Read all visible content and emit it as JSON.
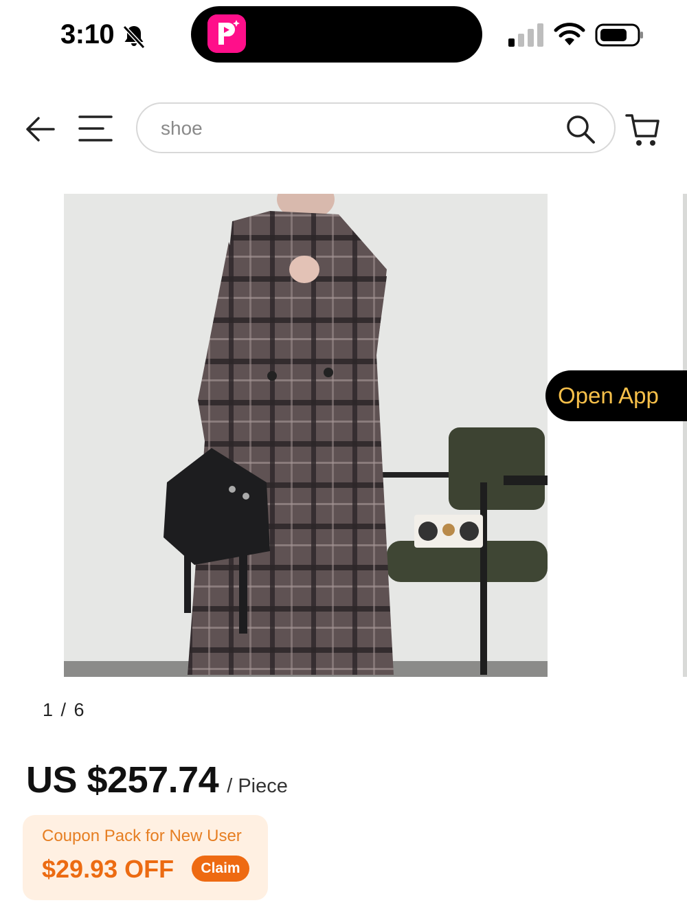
{
  "status_bar": {
    "time": "3:10",
    "icons": [
      "bell-slash-icon",
      "app-badge-icon",
      "signal-icon",
      "wifi-icon",
      "battery-icon"
    ]
  },
  "nav": {
    "search_value": "shoe",
    "icons": [
      "back-arrow-icon",
      "menu-icon",
      "search-icon",
      "cart-icon"
    ]
  },
  "gallery": {
    "counter": "1 / 6",
    "image_alt": "Plaid long coat product photo"
  },
  "open_app_label": "Open App",
  "price": {
    "amount": "US $257.74",
    "unit": "/ Piece"
  },
  "coupon": {
    "title": "Coupon Pack for New User",
    "amount": "$29.93 OFF",
    "claim_label": "Claim"
  },
  "colors": {
    "accent_orange": "#ec6b12",
    "coupon_bg": "#fff0e2",
    "open_app_text": "#f7c04a",
    "app_badge": "#ff0f8a"
  }
}
